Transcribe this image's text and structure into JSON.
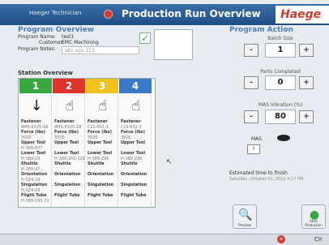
{
  "header": {
    "user": "Haeger Technician",
    "title": "Production Run Overview",
    "brand": "Haege"
  },
  "program_overview": {
    "title": "Program Overview",
    "name_label": "Program Name:",
    "name_value": "test1",
    "customer_label": "Customer:",
    "customer_value": "EMC Machining",
    "notes_label": "Program Notes:",
    "notes_value": "abc-xyz-123"
  },
  "station_overview": {
    "title": "Station Overview",
    "stations": [
      {
        "num": "1",
        "color": "#3aa640",
        "icon": "↓",
        "lines": [
          "Fastener",
          "8MS-6325-18",
          "Force (lbs)",
          "3500",
          "Upper Tool",
          "H-389-607",
          "Lower Tool",
          "H-389-23",
          "Shuttle",
          "H-389-07",
          "Orientation",
          "H-SZ4-29",
          "Singulation",
          "H-SZ4-29",
          "Flight Tube",
          "H-389-295-72"
        ]
      },
      {
        "num": "2",
        "color": "#e0342a",
        "icon": "☝",
        "lines": [
          "Fastener",
          "8MS-6325-18",
          "Force (lbs)",
          "3500",
          "Upper Tool",
          "",
          "Lower Tool",
          "H-389-2A5-128",
          "Shuttle",
          "",
          "Orientation",
          "",
          "Singulation",
          "",
          "Flight Tube",
          ""
        ]
      },
      {
        "num": "3",
        "color": "#f0c21c",
        "icon": "☝",
        "lines": [
          "Fastener",
          "CLS-632-1",
          "Force (lbs)",
          "3500",
          "Upper Tool",
          "",
          "Lower Tool",
          "H-389-Z86",
          "Shuttle",
          "",
          "Orientation",
          "",
          "Singulation",
          "",
          "Flight Tube",
          ""
        ]
      },
      {
        "num": "4",
        "color": "#3a78c8",
        "icon": "☝",
        "lines": [
          "Fastener",
          "CLS-632-1",
          "Force (lbs)",
          "3500",
          "Upper Tool",
          "",
          "Lower Tool",
          "H-389-Z86",
          "Shuttle",
          "",
          "Orientation",
          "",
          "Singulation",
          "",
          "Flight Tube",
          ""
        ]
      }
    ]
  },
  "program_action": {
    "title": "Program Action",
    "batch_label": "Batch Size",
    "batch_value": "1",
    "parts_label": "Parts Completed",
    "parts_value": "0",
    "vibration_label": "MAS Vibration (%)",
    "vibration_value": "80",
    "mas_label": "MAS",
    "mas_toggle": "I",
    "minus": "-",
    "plus": "+",
    "est_label": "Estimated time to finish",
    "est_value": "Saturday, October 01, 2011 4:17 PM",
    "preview_label": "Preview",
    "start_label": "Start Production"
  },
  "statusbar": {
    "clear_label": "Clr"
  }
}
